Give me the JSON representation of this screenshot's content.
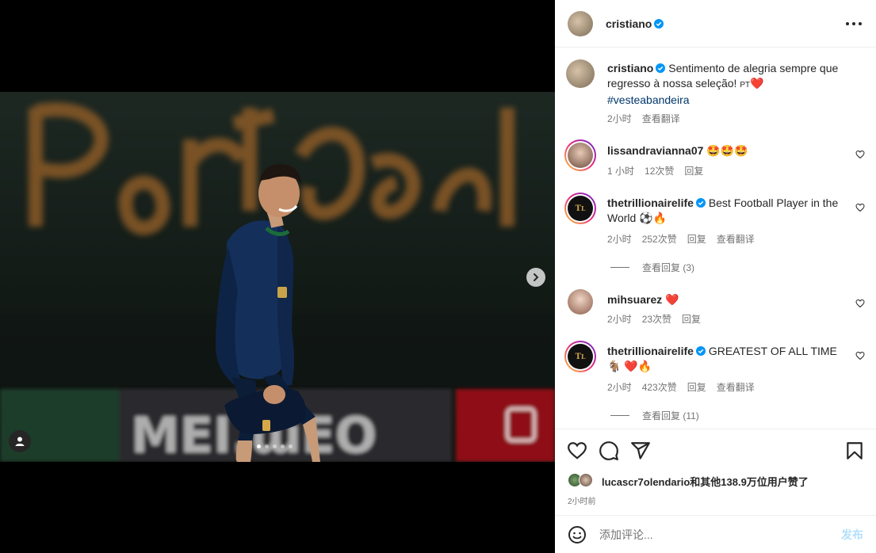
{
  "post": {
    "author": "cristiano",
    "verified": true,
    "caption_user": "cristiano",
    "caption_text": "Sentimento de alegria sempre que regresso à nossa seleção! ",
    "caption_flag": "PT",
    "caption_heart": "❤️",
    "hashtag": "#vesteabandeira",
    "caption_time": "2小时",
    "caption_translate": "查看翻译",
    "carousel_count": 5,
    "carousel_active": 1
  },
  "comments": [
    {
      "user": "lissandravianna07",
      "verified": false,
      "text": "🤩🤩🤩",
      "time": "1 小时",
      "likes": "12次赞",
      "reply": "回复",
      "translate": ""
    },
    {
      "user": "thetrillionairelife",
      "verified": true,
      "text": "Best Football Player in the World ⚽🔥",
      "time": "2小时",
      "likes": "252次赞",
      "reply": "回复",
      "translate": "查看翻译",
      "view_replies": "查看回复 (3)"
    },
    {
      "user": "mihsuarez",
      "verified": false,
      "text": "❤️",
      "time": "2小时",
      "likes": "23次赞",
      "reply": "回复",
      "translate": ""
    },
    {
      "user": "thetrillionairelife",
      "verified": true,
      "text": "GREATEST OF ALL TIME 🐐 ❤️🔥",
      "time": "2小时",
      "likes": "423次赞",
      "reply": "回复",
      "translate": "查看翻译",
      "view_replies": "查看回复 (11)"
    }
  ],
  "likes_summary": "lucascr7olendario和其他138.9万位用户赞了",
  "post_time": "2小时前",
  "compose": {
    "placeholder": "添加评论...",
    "post_label": "发布"
  },
  "icons": {
    "like": "heart-icon",
    "comment": "comment-icon",
    "share": "send-icon",
    "save": "bookmark-icon",
    "emoji": "emoji-icon",
    "more": "more-icon",
    "tag": "user-tag-icon",
    "next": "chevron-right-icon"
  },
  "colors": {
    "verified": "#0095f6",
    "link": "#00376b",
    "muted": "#737373",
    "post_disabled": "#b2dffc",
    "heart_red": "#e0245e"
  }
}
